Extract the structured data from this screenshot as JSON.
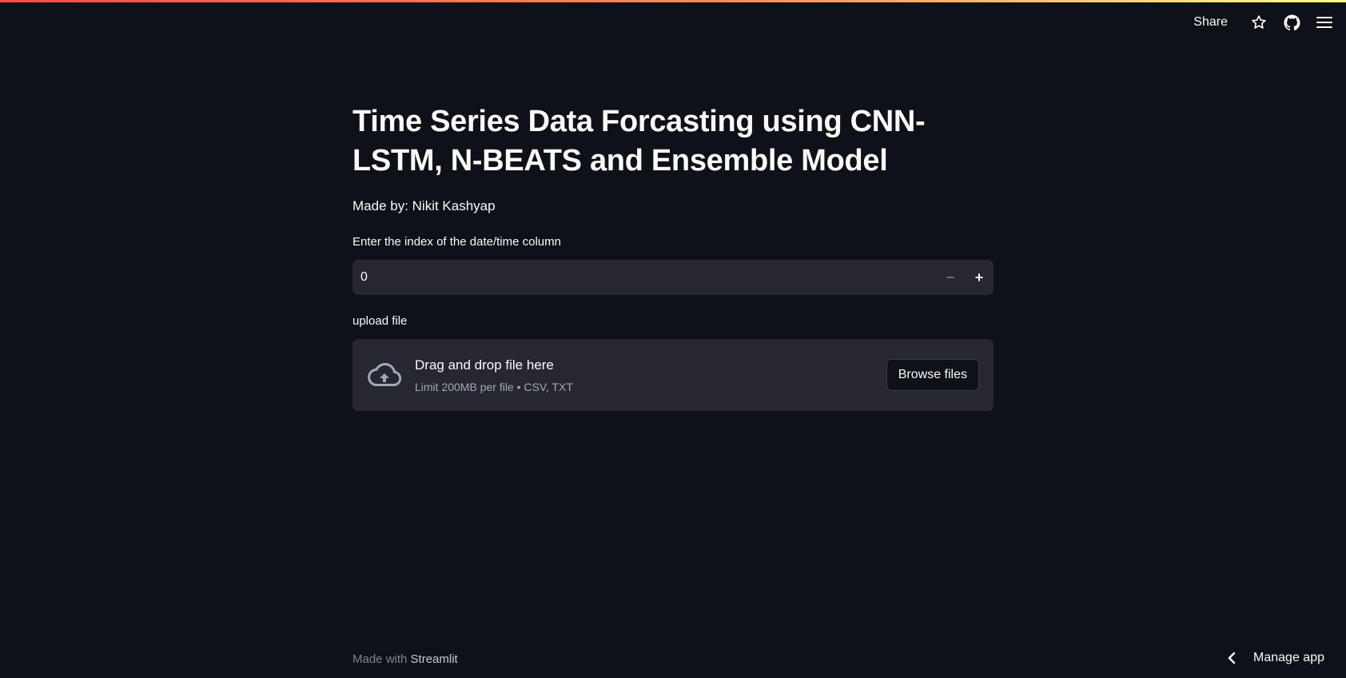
{
  "toolbar": {
    "share_label": "Share",
    "icons": [
      "star-icon",
      "github-icon",
      "hamburger-menu-icon"
    ]
  },
  "main": {
    "title": "Time Series Data Forcasting using CNN-LSTM, N-BEATS and Ensemble Model",
    "byline": "Made by: Nikit Kashyap",
    "number_input": {
      "label": "Enter the index of the date/time column",
      "value": "0",
      "decrement_symbol": "−",
      "increment_symbol": "+"
    },
    "uploader": {
      "label": "upload file",
      "drop_text": "Drag and drop file here",
      "limit_text": "Limit 200MB per file • CSV, TXT",
      "browse_label": "Browse files",
      "icon": "cloud-upload-icon"
    }
  },
  "footer": {
    "made_with": "Made with",
    "brand": "Streamlit"
  },
  "manage_app": {
    "label": "Manage app",
    "icon": "chevron-left-icon"
  },
  "colors": {
    "background": "#0e1117",
    "surface": "#262730",
    "text": "#fafafa",
    "muted": "#a3a8b8",
    "accent_start": "#ff4b4b",
    "accent_end": "#fffd80"
  }
}
